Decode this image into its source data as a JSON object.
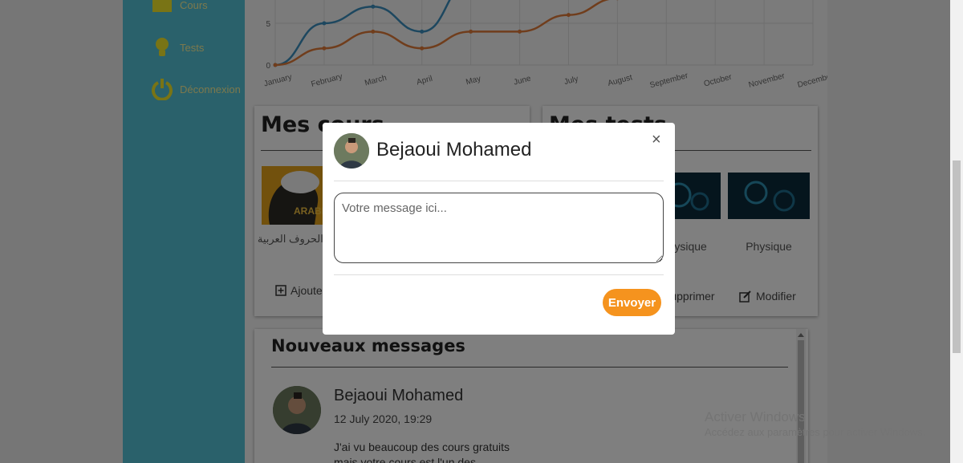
{
  "sidebar": {
    "items": [
      {
        "label": "Cours",
        "icon": "course-icon"
      },
      {
        "label": "Tests",
        "icon": "lightbulb-icon"
      },
      {
        "label": "Déconnexion",
        "icon": "power-icon"
      }
    ]
  },
  "chart_data": {
    "type": "line",
    "categories": [
      "January",
      "February",
      "March",
      "April",
      "May",
      "June",
      "July",
      "August",
      "September",
      "October",
      "November",
      "December"
    ],
    "y_ticks": [
      "0",
      "5"
    ],
    "ylim": [
      0,
      15
    ],
    "series": [
      {
        "values": [
          0,
          5,
          7,
          4,
          10
        ],
        "color": "#3b8fbf"
      },
      {
        "values": [
          0,
          2,
          4,
          2,
          4,
          4,
          6,
          8
        ],
        "color": "#e07b39"
      }
    ]
  },
  "courses_card": {
    "title": "Mes cours",
    "items": [
      {
        "label": "كتابة الحروف العربية",
        "thumb_text": "ARABI"
      }
    ],
    "add_label": "Ajouter"
  },
  "tests_card": {
    "title": "Mes tests",
    "items": [
      {
        "label": "Physique"
      },
      {
        "label": "Physique"
      }
    ],
    "delete_label": "Supprimer",
    "edit_label": "Modifier"
  },
  "messages_card": {
    "title": "Nouveaux messages",
    "messages": [
      {
        "sender": "Bejaoui Mohamed",
        "date": "12 July 2020, 19:29",
        "text": "J'ai vu beaucoup des cours gratuits mais votre cours est l'un des"
      }
    ]
  },
  "modal": {
    "recipient": "Bejaoui Mohamed",
    "close": "×",
    "placeholder": "Votre message ici...",
    "send_label": "Envoyer"
  },
  "watermark": {
    "title": "Activer Windows",
    "subtitle": "Accédez aux paramètres pour activer Windows."
  }
}
